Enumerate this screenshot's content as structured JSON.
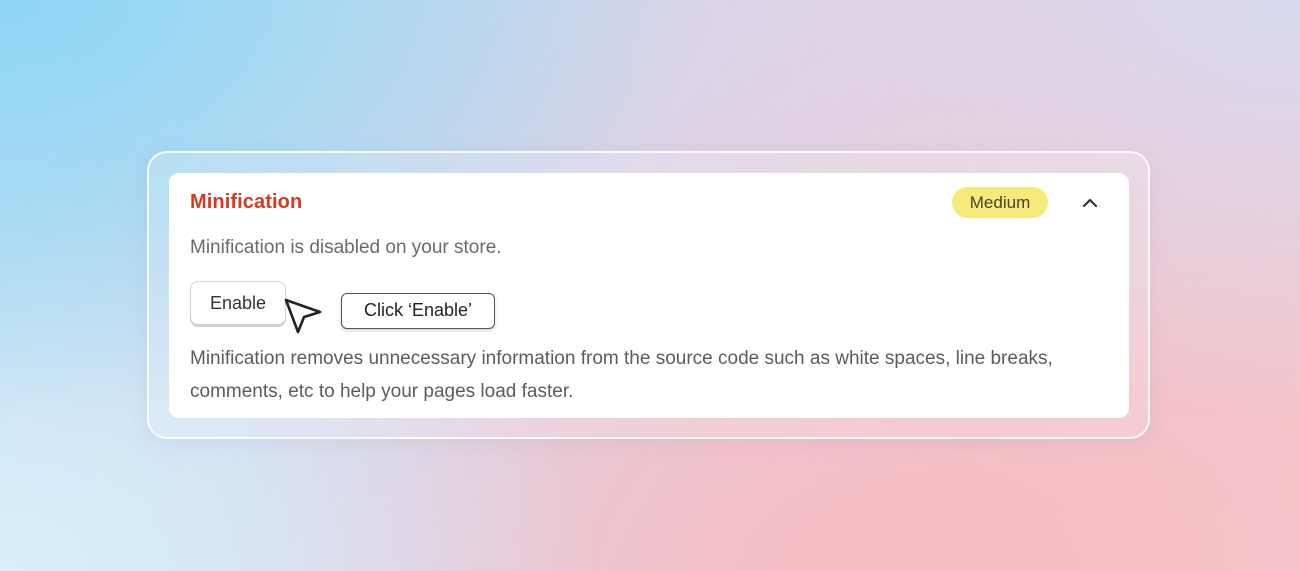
{
  "card": {
    "title": "Minification",
    "severity": "Medium",
    "status_text": "Minification is disabled on your store.",
    "enable_label": "Enable",
    "tooltip_text": "Click ‘Enable’",
    "description": "Minification removes unnecessary information from the source code such as white spaces, line breaks, comments, etc to help your pages load faster.",
    "collapse_icon": "chevron-up-icon",
    "cursor_icon": "pointer-cursor-icon"
  },
  "colors": {
    "title": "#d63a1e",
    "badge_bg": "#f7e97a",
    "card_bg": "#ffffff"
  }
}
